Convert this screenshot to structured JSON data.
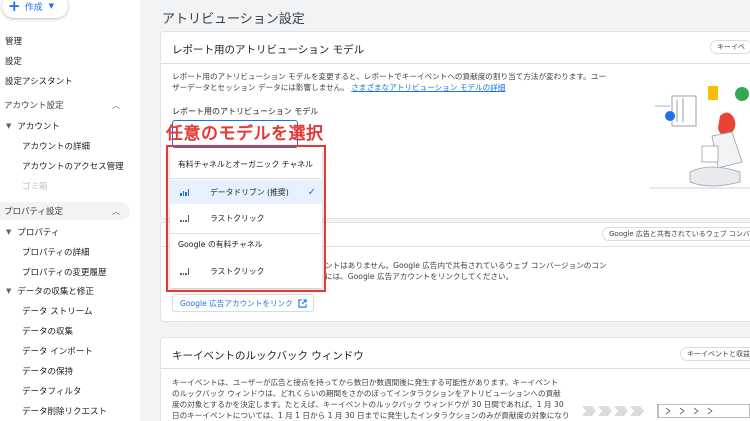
{
  "sidebar": {
    "create_label": "作成",
    "items": {
      "admin": "管理",
      "settings": "設定",
      "setup_assistant": "設定アシスタント"
    },
    "account_settings": {
      "label": "アカウント設定",
      "account": "アカウント",
      "account_details": "アカウントの詳細",
      "account_access": "アカウントのアクセス管理",
      "trash": "ゴミ箱"
    },
    "property_settings": {
      "label": "プロパティ設定",
      "property": "プロパティ",
      "property_details": "プロパティの詳細",
      "property_history": "プロパティの変更履歴",
      "data_collection": "データの収集と修正",
      "data_streams": "データ ストリーム",
      "data_collect": "データの収集",
      "data_import": "データ インポート",
      "data_retention": "データの保持",
      "data_filters": "データフィルタ",
      "data_deletion": "データ削除リクエスト"
    }
  },
  "page": {
    "title": "アトリビューション設定"
  },
  "card1": {
    "title": "レポート用のアトリビューション モデル",
    "chip": "キーイベ",
    "desc_line1": "レポート用のアトリビューション モデルを変更すると、レポートでキーイベントへの貢献度の割り当て方法が変わります。ユー",
    "desc_line2": "ザーデータとセッション データには影響しません。",
    "desc_link": "さまざまなアトリビューション モデルの詳細",
    "field_label": "レポート用のアトリビューション モデル"
  },
  "annotation": "任意のモデルを選択",
  "menu": {
    "group1": "有料チャネルとオーガニック チャネル",
    "opt_data_driven": "データドリブン (推奨)",
    "opt_last_click_1": "ラストクリック",
    "group2": "Google の有料チャネル",
    "opt_last_click_2": "ラストクリック",
    "check": "✓"
  },
  "card2": {
    "chip": "Google 広告と共有されているウェブ コンバージョ",
    "text_line1": "ントはありません。Google 広告内で共有されているウェブ コンバージョンのコン",
    "text_line2": "には、Google 広告アカウントをリンクしてください。",
    "link_button": "Google 広告アカウントをリンク"
  },
  "card3": {
    "title": "キーイベントのルックバック ウィンドウ",
    "chip": "キーイベントと収益デ",
    "text_line1": "キーイベントは、ユーザーが広告と接点を持ってから数日か数週間後に発生する可能性があります。キーイベント",
    "text_line2": "のルックバック ウィンドウは、どれくらいの期間をさかのぼってインタラクションをアトリビューションへの貢献",
    "text_line3": "度の対象とするかを決定します。たとえば、キーイベントのルックバック ウィンドウが 30 日間であれば、1 月 30",
    "text_line4": "日のキーイベントについては、1 月 1 日から 1 月 30 日までに発生したインタラクションのみが貢献度の対象になり"
  },
  "colors": {
    "accent": "#1a73e8",
    "annotation": "#e53935",
    "selected_bg": "#e8f0fe"
  }
}
